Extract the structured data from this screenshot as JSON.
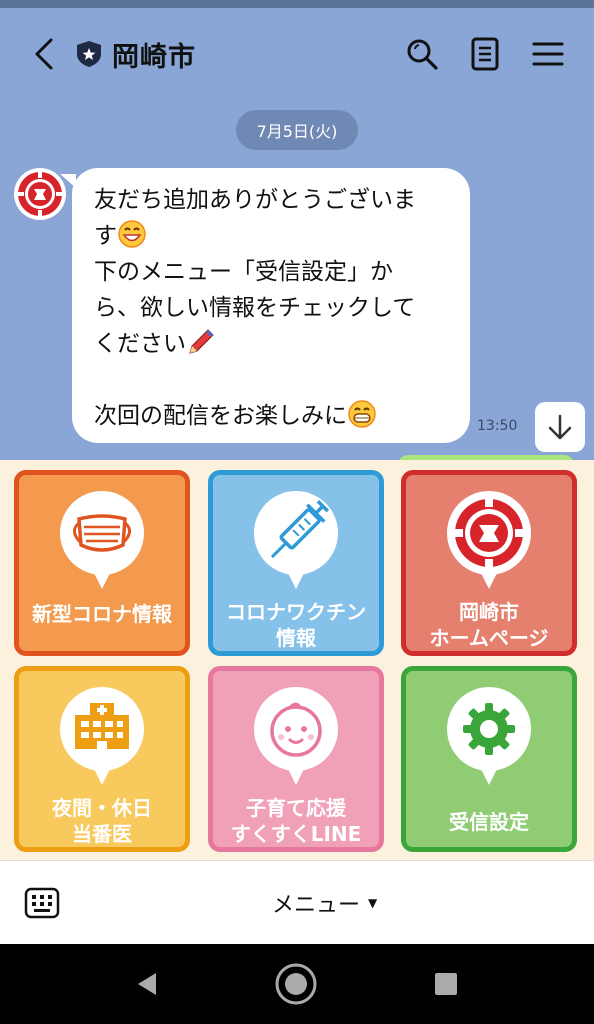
{
  "header": {
    "title": "岡崎市"
  },
  "chat": {
    "date": "7月5日(火)",
    "message_lines": [
      "友だち追加ありがとうございま",
      "す",
      "下のメニュー「受信設定」か",
      "ら、欲しい情報をチェックして",
      "ください",
      "",
      "次回の配信をお楽しみに"
    ],
    "time": "13:50"
  },
  "rich_menu": {
    "tiles": [
      {
        "label_line1": "新型コロナ情報",
        "label_line2": "",
        "icon": "mask-icon",
        "color": "#f39a4f",
        "border": "#e0551f"
      },
      {
        "label_line1": "コロナワクチン",
        "label_line2": "情報",
        "icon": "syringe-icon",
        "color": "#86c1ea",
        "border": "#2f9bd6"
      },
      {
        "label_line1": "岡崎市",
        "label_line2": "ホームページ",
        "icon": "city-emblem-icon",
        "color": "#e57f6e",
        "border": "#cf2e2c"
      },
      {
        "label_line1": "夜間・休日",
        "label_line2": "当番医",
        "icon": "hospital-icon",
        "color": "#f8c95c",
        "border": "#ee9e12"
      },
      {
        "label_line1": "子育て応援",
        "label_line2": "すくすくLINE",
        "icon": "baby-face-icon",
        "color": "#f0a1b8",
        "border": "#e678a0"
      },
      {
        "label_line1": "受信設定",
        "label_line2": "",
        "icon": "gear-icon",
        "color": "#8fcc74",
        "border": "#3aa63a"
      }
    ]
  },
  "bottom_bar": {
    "menu_label": "メニュー"
  }
}
